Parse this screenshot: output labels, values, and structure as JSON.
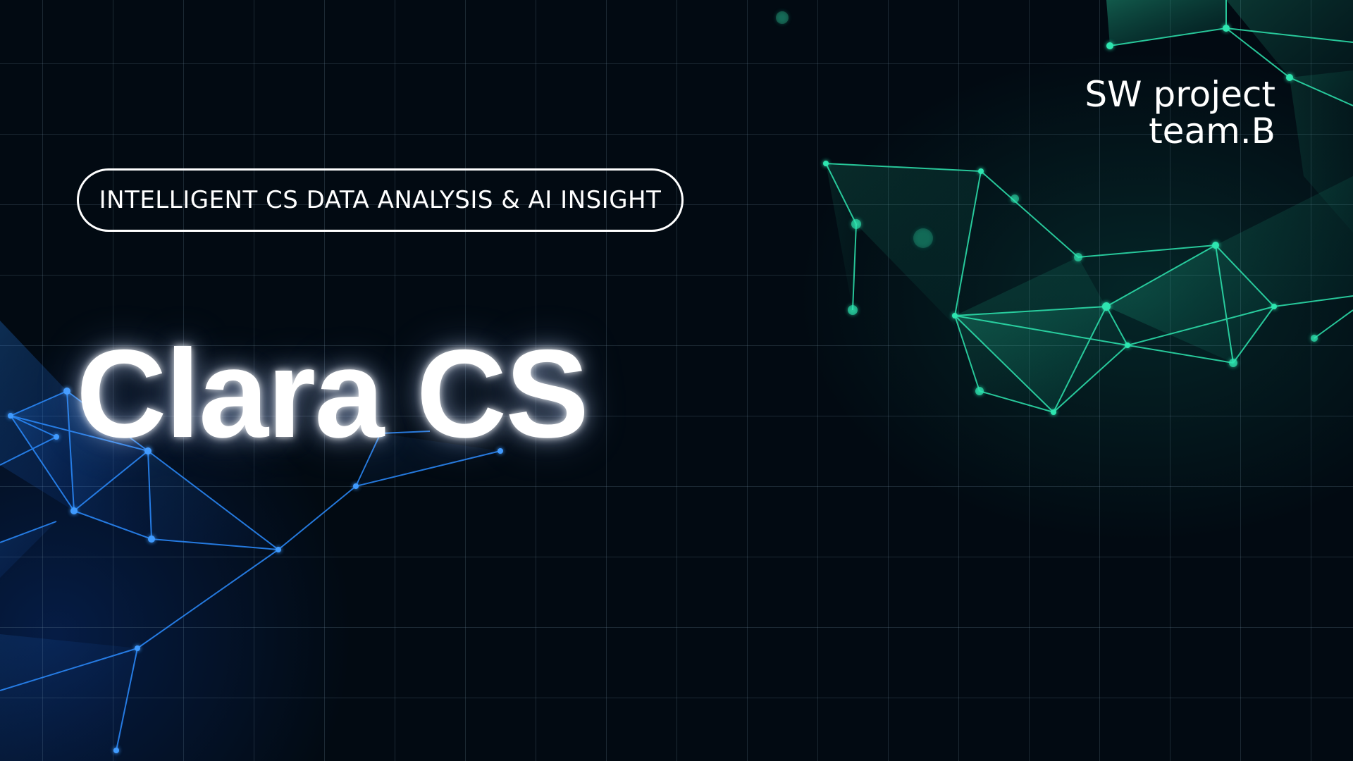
{
  "tagline": "INTELLIGENT CS DATA ANALYSIS & AI INSIGHT",
  "title": "Clara CS",
  "team": {
    "line1": "SW project",
    "line2": "team.B"
  },
  "colors": {
    "background": "#020a12",
    "accent_green": "#2ee6b0",
    "accent_blue": "#2b8cff",
    "text": "#ffffff"
  }
}
